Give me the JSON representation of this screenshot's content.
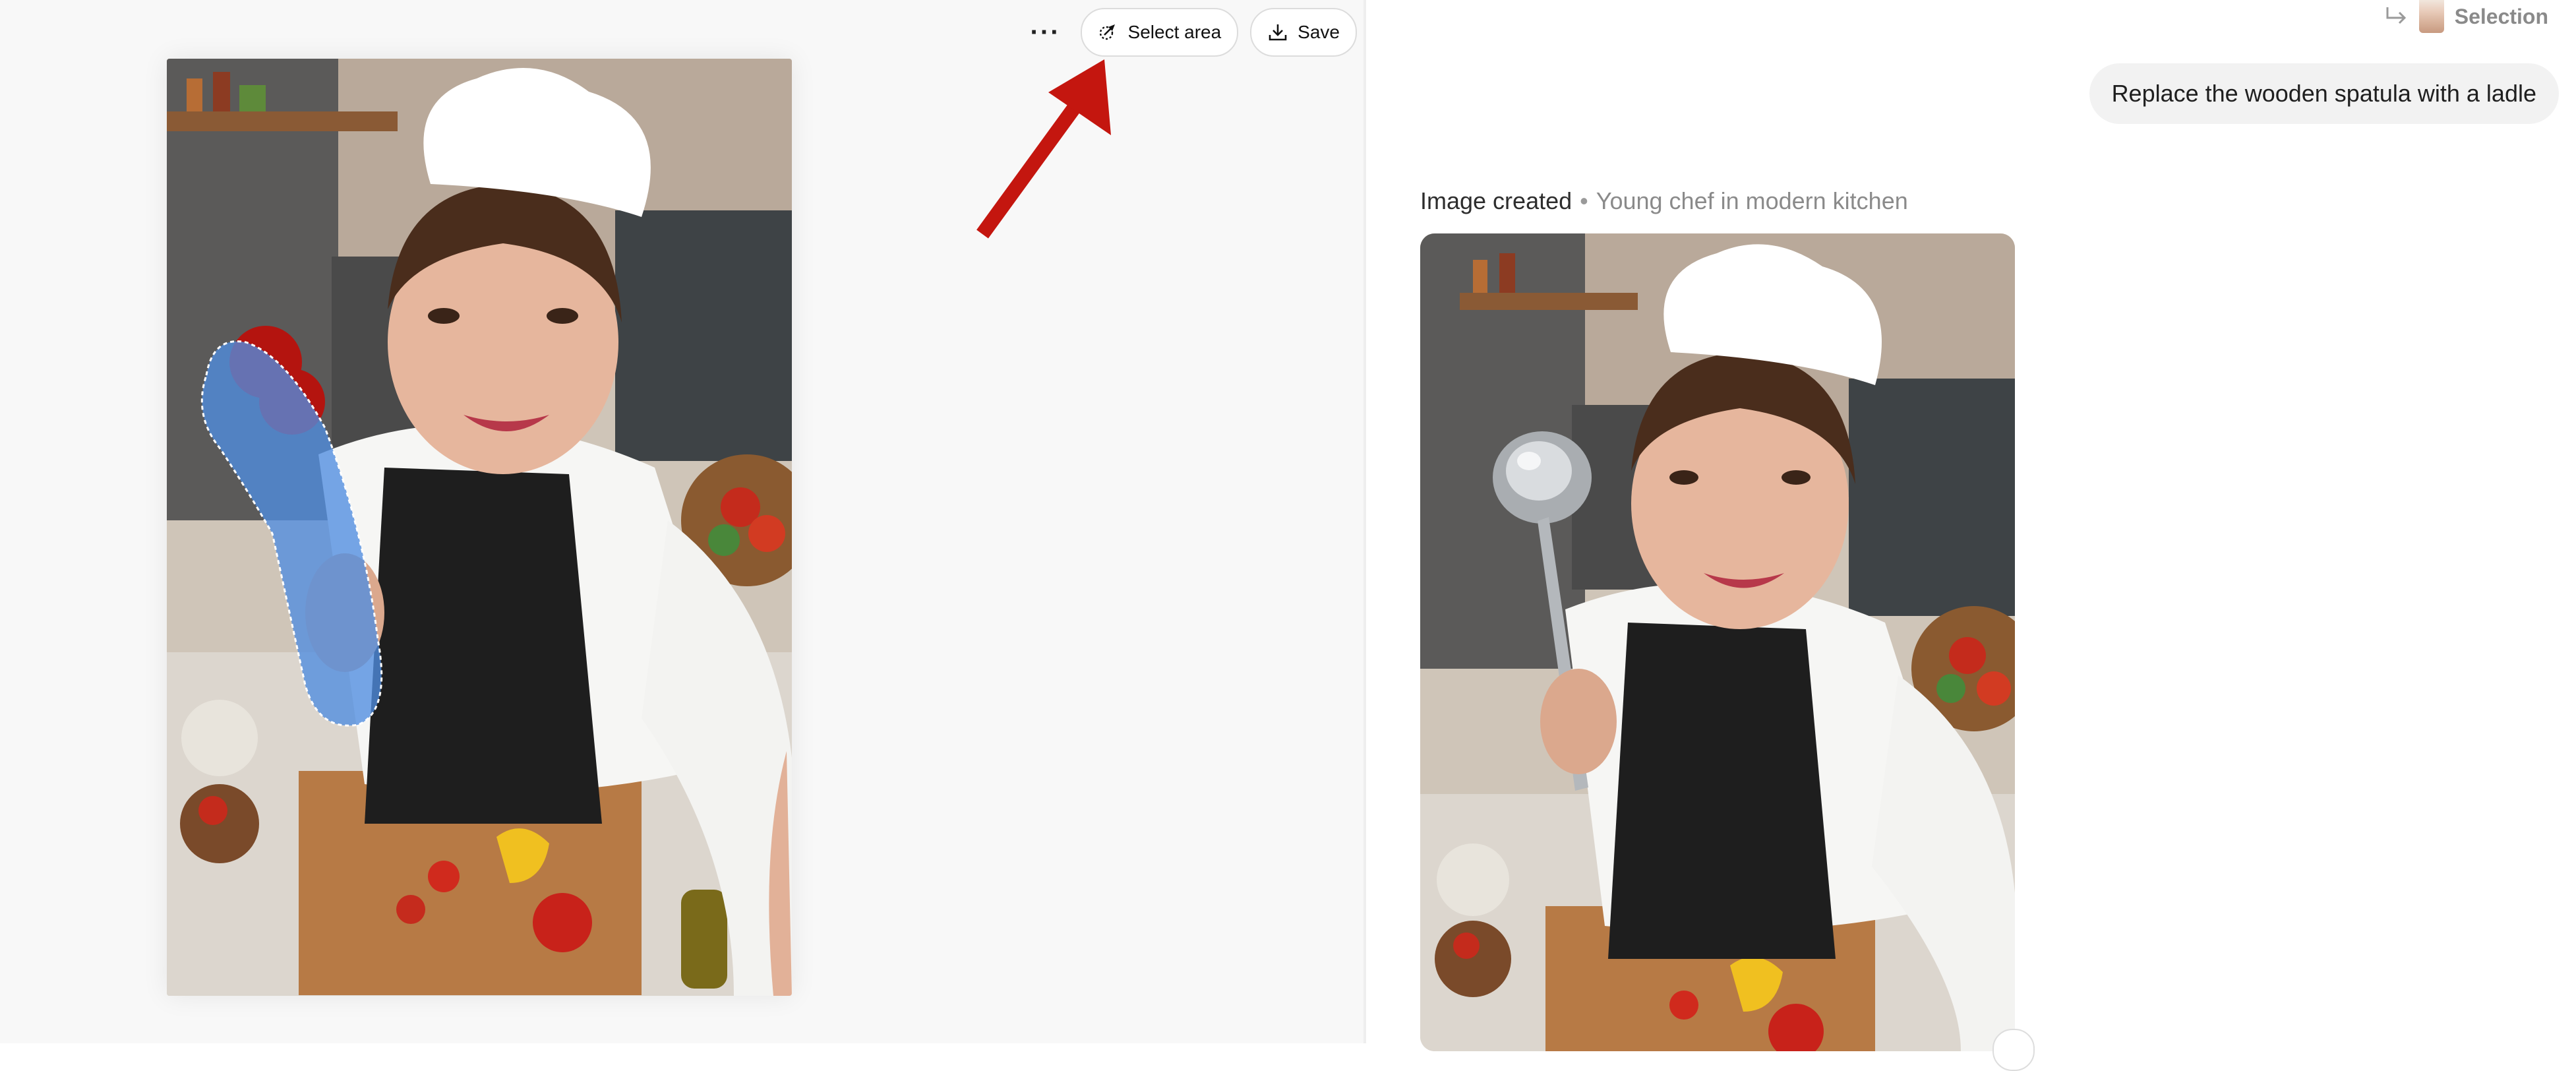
{
  "toolbar": {
    "more_label": "···",
    "select_area_label": "Select area",
    "save_label": "Save"
  },
  "chat": {
    "selection_label": "Selection",
    "user_message": "Replace the wooden spatula with a ladle",
    "result": {
      "status": "Image created",
      "separator": "•",
      "caption": "Young chef in modern kitchen"
    }
  },
  "colors": {
    "annotation_arrow": "#c4160f",
    "selection_mask": "#4f8de0",
    "pill_border": "#dcdcdc"
  },
  "icons": {
    "more": "more-horizontal-icon",
    "select_area": "select-area-icon",
    "save": "download-icon",
    "selection_reply": "reply-arrow-icon"
  }
}
